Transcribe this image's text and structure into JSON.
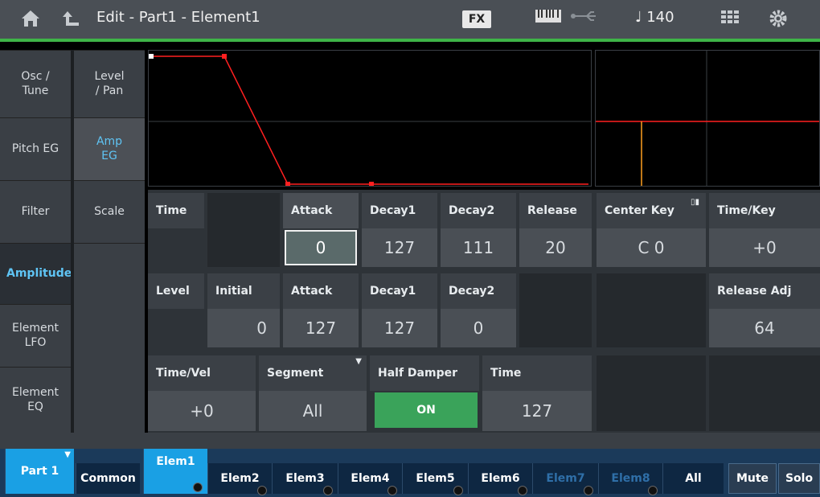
{
  "header": {
    "title": "Edit - Part1 - Element1",
    "fx_label": "FX",
    "tempo": "♩ 140",
    "home_icon": "home-icon",
    "back_icon": "return-icon",
    "keyboard_icon": "keyboard-icon",
    "usb_icon": "usb-icon",
    "grid_icon": "grid-icon",
    "settings_icon": "gear-icon"
  },
  "left_menu": {
    "col1": [
      {
        "label": "Osc /\nTune"
      },
      {
        "label": "Pitch EG"
      },
      {
        "label": "Filter"
      },
      {
        "label": "Amplitude"
      },
      {
        "label": "Element\nLFO"
      },
      {
        "label": "Element\nEQ"
      }
    ],
    "col2": [
      {
        "label": "Level\n/ Pan"
      },
      {
        "label": "Amp\nEG"
      },
      {
        "label": "Scale"
      }
    ]
  },
  "params": {
    "time_label": "Time",
    "level_label": "Level",
    "time_row": {
      "attack": {
        "label": "Attack",
        "value": "0"
      },
      "decay1": {
        "label": "Decay1",
        "value": "127"
      },
      "decay2": {
        "label": "Decay2",
        "value": "111"
      },
      "release": {
        "label": "Release",
        "value": "20"
      }
    },
    "level_row": {
      "initial": {
        "label": "Initial",
        "value": "0"
      },
      "attack": {
        "label": "Attack",
        "value": "127"
      },
      "decay1": {
        "label": "Decay1",
        "value": "127"
      },
      "decay2": {
        "label": "Decay2",
        "value": "0"
      }
    },
    "center_key": {
      "label": "Center Key",
      "value": "C 0"
    },
    "time_key": {
      "label": "Time/Key",
      "value": "+0"
    },
    "release_adj": {
      "label": "Release Adj",
      "value": "64"
    },
    "time_vel": {
      "label": "Time/Vel",
      "value": "+0"
    },
    "segment": {
      "label": "Segment",
      "value": "All"
    },
    "half_damper": {
      "label": "Half Damper",
      "value": "ON"
    },
    "hd_time": {
      "label": "Time",
      "value": "127"
    }
  },
  "bottom_tabs": {
    "part": "Part 1",
    "common": "Common",
    "elems": [
      "Elem1",
      "Elem2",
      "Elem3",
      "Elem4",
      "Elem5",
      "Elem6",
      "Elem7",
      "Elem8"
    ],
    "all": "All",
    "mute": "Mute",
    "solo": "Solo"
  },
  "colors": {
    "accent": "#1aa0e4",
    "envelope": "#ff2020",
    "center_key_line": "#ffa020",
    "on_button": "#3aa35a"
  }
}
